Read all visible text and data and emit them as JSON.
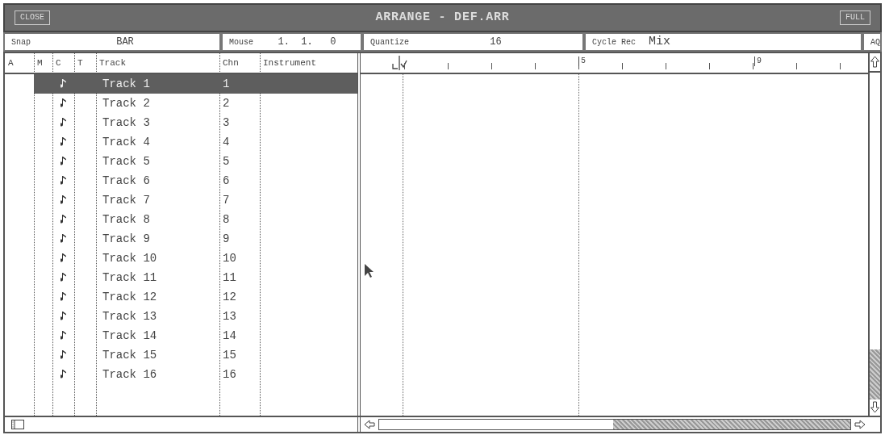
{
  "window": {
    "title": "ARRANGE - DEF.ARR",
    "close_button": "CLOSE",
    "full_button": "FULL"
  },
  "info_bar": [
    {
      "label": "Snap",
      "value": "BAR"
    },
    {
      "label": "Mouse",
      "value": "1.  1.   0"
    },
    {
      "label": "Quantize",
      "value": "16"
    },
    {
      "label": "Cycle Rec",
      "value": "Mix"
    },
    {
      "label": "AQ"
    }
  ],
  "columns": [
    "A",
    "M",
    "C",
    "T",
    "Track",
    "Chn",
    "Instrument"
  ],
  "ruler": {
    "labels": [
      "5",
      "9"
    ]
  },
  "tracks": [
    {
      "name": "Track 1",
      "channel": "1",
      "selected": true
    },
    {
      "name": "Track 2",
      "channel": "2",
      "selected": false
    },
    {
      "name": "Track 3",
      "channel": "3",
      "selected": false
    },
    {
      "name": "Track 4",
      "channel": "4",
      "selected": false
    },
    {
      "name": "Track 5",
      "channel": "5",
      "selected": false
    },
    {
      "name": "Track 6",
      "channel": "6",
      "selected": false
    },
    {
      "name": "Track 7",
      "channel": "7",
      "selected": false
    },
    {
      "name": "Track 8",
      "channel": "8",
      "selected": false
    },
    {
      "name": "Track 9",
      "channel": "9",
      "selected": false
    },
    {
      "name": "Track 10",
      "channel": "10",
      "selected": false
    },
    {
      "name": "Track 11",
      "channel": "11",
      "selected": false
    },
    {
      "name": "Track 12",
      "channel": "12",
      "selected": false
    },
    {
      "name": "Track 13",
      "channel": "13",
      "selected": false
    },
    {
      "name": "Track 14",
      "channel": "14",
      "selected": false
    },
    {
      "name": "Track 15",
      "channel": "15",
      "selected": false
    },
    {
      "name": "Track 16",
      "channel": "16",
      "selected": false
    }
  ]
}
